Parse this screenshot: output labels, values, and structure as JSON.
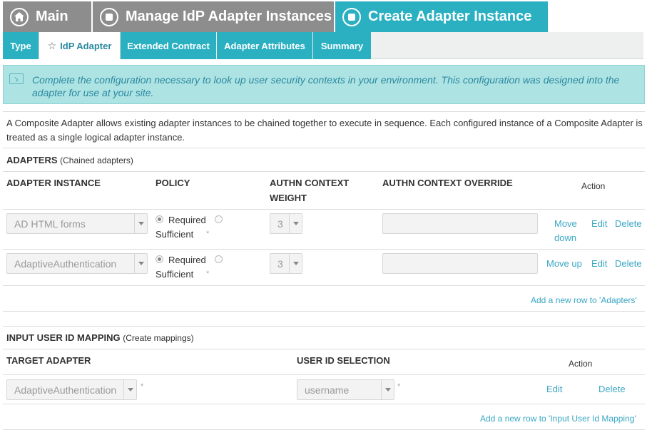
{
  "breadcrumbs": [
    {
      "label": "Main",
      "icon": "home-icon"
    },
    {
      "label": "Manage IdP Adapter Instances",
      "icon": "step-circle-icon"
    },
    {
      "label": "Create Adapter Instance",
      "icon": "step-circle-icon"
    }
  ],
  "tabs": [
    {
      "label": "Type"
    },
    {
      "label": "IdP Adapter",
      "active": true
    },
    {
      "label": "Extended Contract"
    },
    {
      "label": "Adapter Attributes"
    },
    {
      "label": "Summary"
    }
  ],
  "info_message": "Complete the configuration necessary to look up user security contexts in your environment. This configuration was designed into the adapter for use at your site.",
  "description": "A Composite Adapter allows existing adapter instances to be chained together to execute in sequence. Each configured instance of a Composite Adapter is treated as a single logical adapter instance.",
  "adapters": {
    "title": "ADAPTERS",
    "subtitle": "(Chained adapters)",
    "columns": {
      "instance": "ADAPTER INSTANCE",
      "policy": "POLICY",
      "weight_line1": "AUTHN CONTEXT",
      "weight_line2": "WEIGHT",
      "override": "AUTHN CONTEXT OVERRIDE",
      "action": "Action"
    },
    "rows": [
      {
        "instance": "AD HTML forms",
        "policy_required": "Required",
        "policy_sufficient": "Sufficient",
        "required_mark": "*",
        "weight": "3",
        "override": "",
        "move_line1": "Move",
        "move_line2": "down",
        "edit": "Edit",
        "delete": "Delete"
      },
      {
        "instance": "AdaptiveAuthentication",
        "policy_required": "Required",
        "policy_sufficient": "Sufficient",
        "required_mark": "*",
        "weight": "3",
        "override": "",
        "move": "Move up",
        "edit": "Edit",
        "delete": "Delete"
      }
    ],
    "add_row": "Add a new row to 'Adapters'"
  },
  "mapping": {
    "title": "INPUT USER ID MAPPING",
    "subtitle": "(Create mappings)",
    "columns": {
      "target": "TARGET ADAPTER",
      "selection": "USER ID SELECTION",
      "action": "Action"
    },
    "rows": [
      {
        "target": "AdaptiveAuthentication",
        "target_mark": "*",
        "selection": "username",
        "selection_mark": "*",
        "edit": "Edit",
        "delete": "Delete"
      }
    ],
    "add_row": "Add a new row to 'Input User Id Mapping'"
  },
  "colors": {
    "accent": "#2bb0c2",
    "inactive_crumb": "#8d8d8d",
    "info_bg": "#ade3e3",
    "link": "#3aa7c4"
  }
}
